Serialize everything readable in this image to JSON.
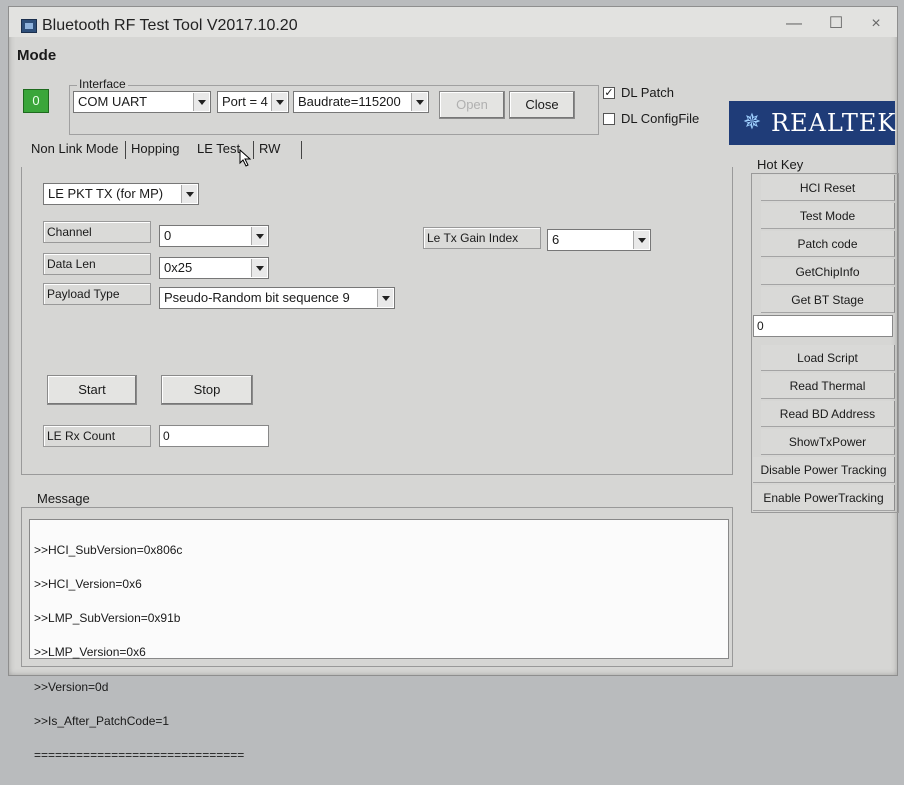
{
  "window": {
    "title": "Bluetooth RF Test Tool V2017.10.20",
    "minimize_glyph": "—",
    "maximize_glyph": "☐",
    "close_glyph": "×"
  },
  "mode_label": "Mode",
  "interface": {
    "group_title": "Interface",
    "status_value": "0",
    "com_select": "COM UART",
    "port_select": "Port = 4",
    "baud_select": "Baudrate=115200",
    "open_label": "Open",
    "close_label": "Close"
  },
  "options": {
    "dl_patch": {
      "label": "DL Patch",
      "checked": true
    },
    "dl_configfile": {
      "label": "DL ConfigFile",
      "checked": false
    }
  },
  "logo": {
    "text": "REALTEK",
    "icon": "realtek-logo-icon"
  },
  "tabs": [
    {
      "label": "Non Link Mode"
    },
    {
      "label": "Hopping"
    },
    {
      "label": "LE Test"
    },
    {
      "label": "RW"
    }
  ],
  "le_test": {
    "mode_select": "LE PKT TX (for MP)",
    "channel_label": "Channel",
    "channel_value": "0",
    "data_len_label": "Data Len",
    "data_len_value": "0x25",
    "payload_type_label": "Payload Type",
    "payload_type_value": "Pseudo-Random bit sequence 9",
    "tx_gain_label": "Le Tx Gain Index",
    "tx_gain_value": "6",
    "start_label": "Start",
    "stop_label": "Stop",
    "rx_count_label": "LE Rx Count",
    "rx_count_value": "0"
  },
  "hotkey": {
    "tab_label": "Hot Key",
    "buttons_top": [
      "HCI Reset",
      "Test Mode",
      "Patch code",
      "GetChipInfo",
      "Get BT Stage"
    ],
    "field_value": "0",
    "buttons_bottom": [
      "Load Script",
      "Read Thermal",
      "Read BD Address",
      "ShowTxPower",
      "Disable Power Tracking",
      "Enable PowerTracking"
    ]
  },
  "message": {
    "tab_label": "Message",
    "lines": [
      ">>HCI_SubVersion=0x806c",
      ">>HCI_Version=0x6",
      ">>LMP_SubVersion=0x91b",
      ">>LMP_Version=0x6",
      ">>Version=0d",
      ">>Is_After_PatchCode=1",
      "=============================="
    ]
  }
}
